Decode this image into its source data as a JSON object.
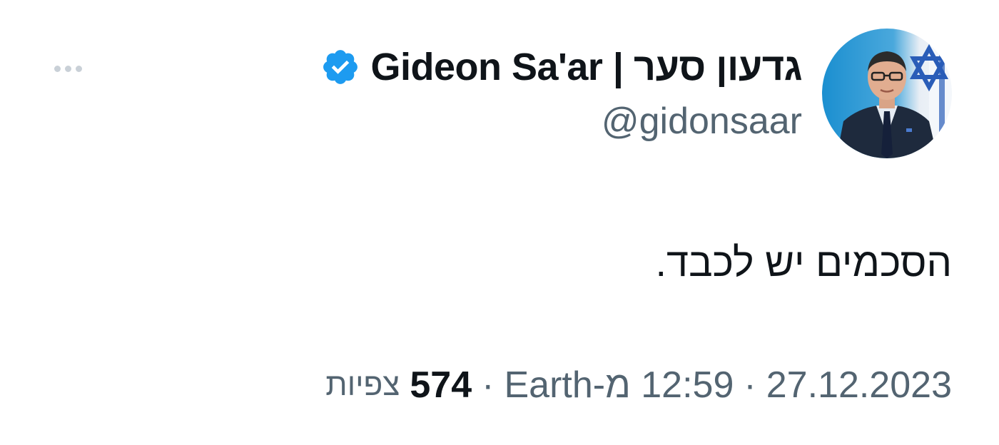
{
  "author": {
    "display_name": "Gideon Sa'ar | גדעון סער",
    "handle": "@gidonsaar",
    "verified": true,
    "avatar": "avatar-photo"
  },
  "tweet": {
    "text": "הסכמים יש לכבד."
  },
  "meta": {
    "date": "27.12.2023",
    "separator_1": "·",
    "time_source": "12:59 מ-Earth",
    "separator_2": "·",
    "views_count": "574",
    "views_label": "צפיות"
  },
  "icons": {
    "more": "more-horizontal-icon",
    "verified": "verified-badge-icon"
  },
  "colors": {
    "verified_blue": "#1d9bf0",
    "text_primary": "#0f1419",
    "text_secondary": "#536471",
    "more_dots": "#c9d0d7"
  }
}
